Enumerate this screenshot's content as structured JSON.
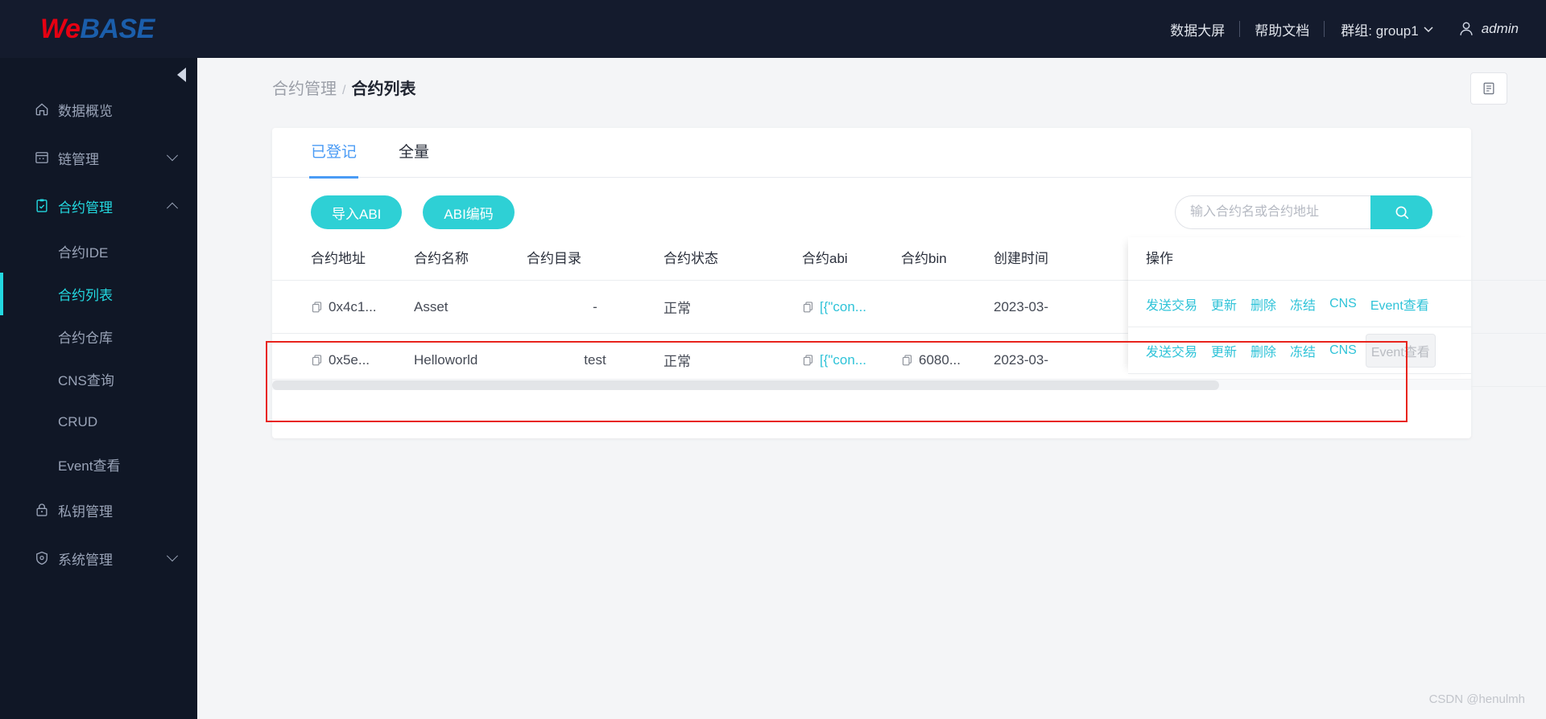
{
  "header": {
    "logo_we": "We",
    "logo_base": "BASE",
    "nav": [
      {
        "label": "数据大屏"
      },
      {
        "label": "帮助文档"
      }
    ],
    "group_label": "群组: group1",
    "user": "admin"
  },
  "sidebar": {
    "items": [
      {
        "label": "数据概览",
        "icon": "home-icon",
        "type": "item",
        "state": "normal"
      },
      {
        "label": "链管理",
        "icon": "chain-icon",
        "type": "item",
        "state": "normal",
        "caret": "down"
      },
      {
        "label": "合约管理",
        "icon": "contract-icon",
        "type": "item",
        "state": "active",
        "caret": "up"
      },
      {
        "label": "合约IDE",
        "type": "sub",
        "state": "normal"
      },
      {
        "label": "合约列表",
        "type": "sub",
        "state": "current"
      },
      {
        "label": "合约仓库",
        "type": "sub",
        "state": "normal"
      },
      {
        "label": "CNS查询",
        "type": "sub",
        "state": "normal"
      },
      {
        "label": "CRUD",
        "type": "sub",
        "state": "normal"
      },
      {
        "label": "Event查看",
        "type": "sub",
        "state": "normal"
      },
      {
        "label": "私钥管理",
        "icon": "lock-icon",
        "type": "item",
        "state": "normal"
      },
      {
        "label": "系统管理",
        "icon": "shield-icon",
        "type": "item",
        "state": "normal",
        "caret": "down"
      }
    ]
  },
  "breadcrumb": {
    "parent": "合约管理",
    "separator": "/",
    "current": "合约列表"
  },
  "main": {
    "tabs": [
      {
        "label": "已登记",
        "active": true
      },
      {
        "label": "全量",
        "active": false
      }
    ],
    "buttons": {
      "import_abi": "导入ABI",
      "abi_encode": "ABI编码"
    },
    "search": {
      "value": "",
      "placeholder": "输入合约名或合约地址"
    },
    "table": {
      "headers": [
        "合约地址",
        "合约名称",
        "合约目录",
        "合约状态",
        "合约abi",
        "合约bin",
        "创建时间"
      ],
      "action_header": "操作",
      "rows": [
        {
          "address": "0x4c1...",
          "name": "Asset",
          "dir": "-",
          "status": "正常",
          "abi": "[{\"con...",
          "bin": "",
          "created": "2023-03-",
          "name_is_link": false,
          "dir_is_link": false,
          "actions": [
            {
              "label": "发送交易",
              "state": "normal"
            },
            {
              "label": "更新",
              "state": "normal"
            },
            {
              "label": "删除",
              "state": "normal"
            },
            {
              "label": "冻结",
              "state": "normal"
            },
            {
              "label": "CNS",
              "state": "normal"
            },
            {
              "label": "Event查看",
              "state": "normal"
            }
          ]
        },
        {
          "address": "0x5e...",
          "name": "Helloworld",
          "dir": "test",
          "status": "正常",
          "abi": "[{\"con...",
          "bin": "6080...",
          "created": "2023-03-",
          "name_is_link": true,
          "dir_is_link": true,
          "actions": [
            {
              "label": "发送交易",
              "state": "normal"
            },
            {
              "label": "更新",
              "state": "normal"
            },
            {
              "label": "删除",
              "state": "normal"
            },
            {
              "label": "冻结",
              "state": "normal"
            },
            {
              "label": "CNS",
              "state": "normal"
            },
            {
              "label": "Event查看",
              "state": "hovered"
            }
          ]
        }
      ]
    }
  },
  "watermark": "CSDN @henulmh",
  "colors": {
    "accent_cyan": "#2ed0d5",
    "tab_blue": "#4a9bf5",
    "sidebar_bg": "#101726",
    "topbar_bg": "#141b2d",
    "annotation_red": "#e8241d",
    "logo_red": "#e60012",
    "logo_blue": "#1b5eab"
  }
}
